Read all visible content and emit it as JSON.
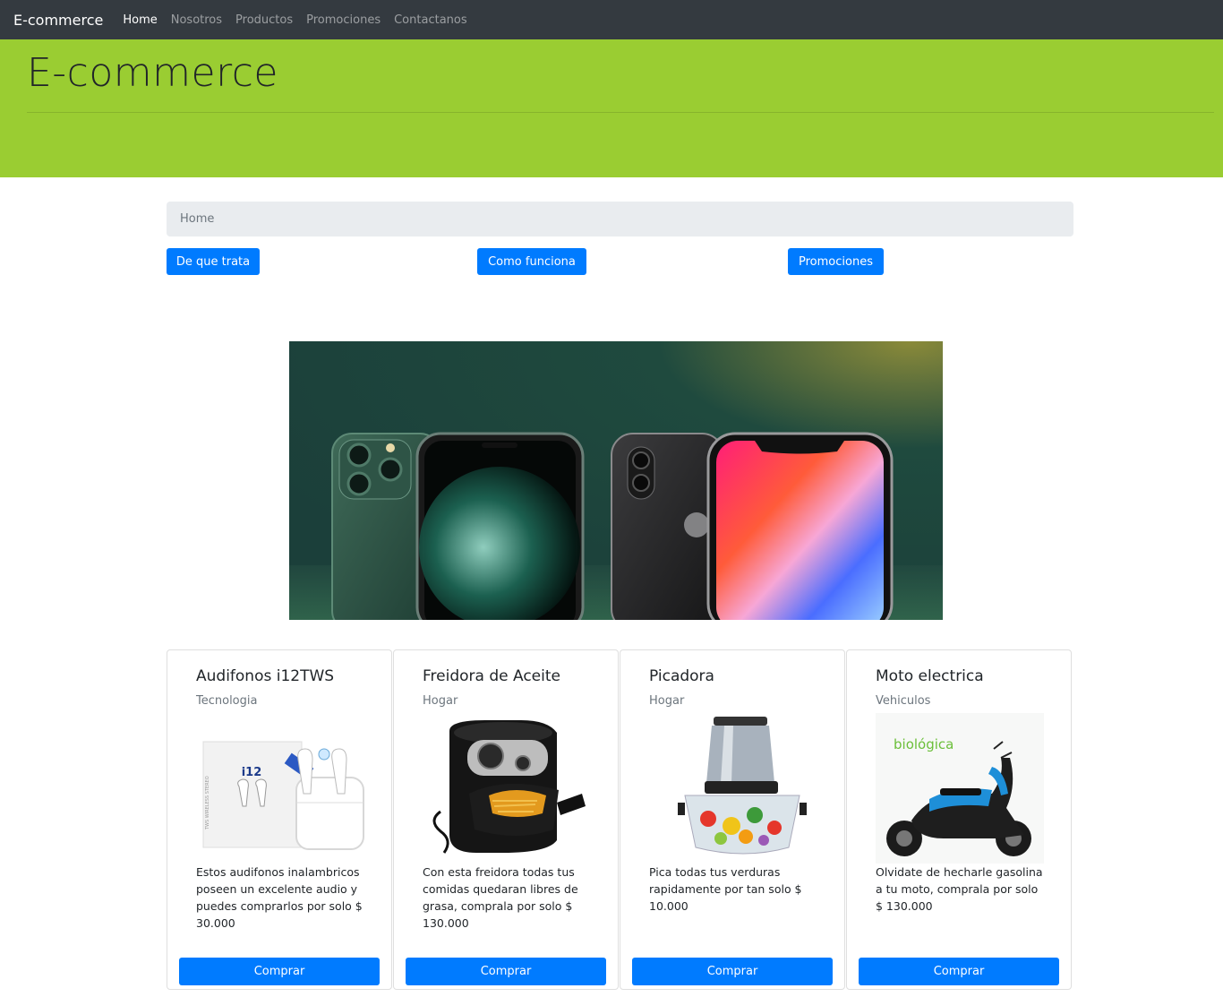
{
  "navbar": {
    "brand": "E-commerce",
    "links": [
      "Home",
      "Nosotros",
      "Productos",
      "Promociones",
      "Contactanos"
    ]
  },
  "jumbotron": {
    "title": "E-commerce"
  },
  "breadcrumb": {
    "current": "Home"
  },
  "actions": [
    "De que trata",
    "Como funciona",
    "Promociones"
  ],
  "cards": [
    {
      "title": "Audifonos i12TWS",
      "category": "Tecnologia",
      "box_label": "i12",
      "box_side_text": "TWS WIRELESS STEREO",
      "text": "Estos audifonos inalambricos poseen un excelente audio y puedes comprarlos por solo $ 30.000",
      "button": "Comprar"
    },
    {
      "title": "Freidora de Aceite",
      "category": "Hogar",
      "text": "Con esta freidora todas tus comidas quedaran libres de grasa, comprala por solo $ 130.000",
      "button": "Comprar"
    },
    {
      "title": "Picadora",
      "category": "Hogar",
      "text": "Pica todas tus verduras rapidamente por tan solo $ 10.000",
      "button": "Comprar"
    },
    {
      "title": "Moto electrica",
      "category": "Vehiculos",
      "logo_text": "biológica",
      "text": "Olvidate de hecharle gasolina a tu moto, comprala por solo $ 130.000",
      "button": "Comprar"
    }
  ],
  "colors": {
    "navbar": "#343a40",
    "jumbotron": "#9acd32",
    "primary": "#007bff",
    "breadcrumb": "#e9ecef"
  }
}
